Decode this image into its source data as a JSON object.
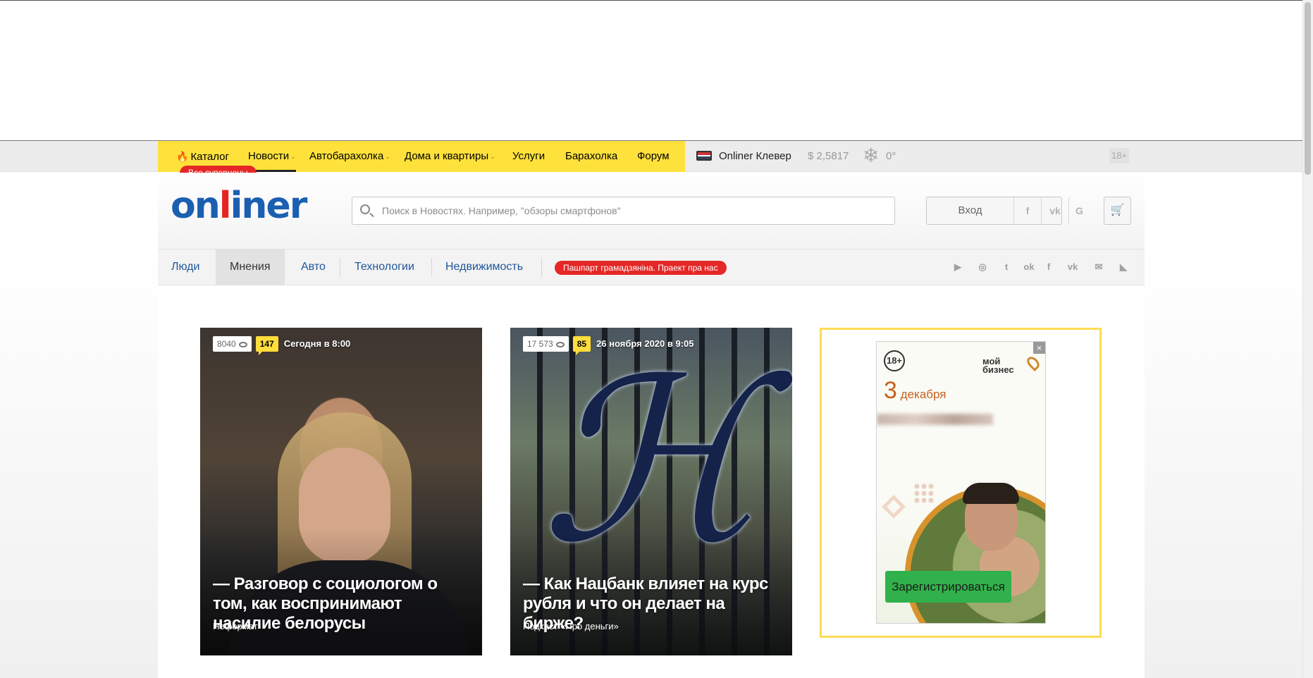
{
  "topnav": {
    "items": [
      {
        "label": "Каталог",
        "dropdown": false
      },
      {
        "label": "Новости",
        "dropdown": true
      },
      {
        "label": "Автобарахолка",
        "dropdown": true
      },
      {
        "label": "Дома и квартиры",
        "dropdown": true
      },
      {
        "label": "Услуги",
        "dropdown": false
      },
      {
        "label": "Барахолка",
        "dropdown": false
      },
      {
        "label": "Форум",
        "dropdown": false
      }
    ],
    "badge": "Все суперцены",
    "clever": "Onliner Клевер",
    "currency": "$ 2,5817",
    "temperature": "0°",
    "age": "18+"
  },
  "header": {
    "logo": {
      "part1": "on",
      "part2": "l",
      "part3": "iner"
    },
    "search_placeholder": "Поиск в Новостях. Например, \"обзоры смартфонов\"",
    "login_label": "Вход",
    "social_login": [
      "f",
      "vk",
      "G"
    ],
    "icons": {
      "search": "search-icon",
      "cart": "cart-icon"
    }
  },
  "subnav": {
    "items": [
      "Люди",
      "Мнения",
      "Авто",
      "Технологии",
      "Недвижимость"
    ],
    "active": "Мнения",
    "promo": "Пашпарт грамадзяніна. Праект пра нас",
    "social_icons": [
      "youtube-icon",
      "instagram-icon",
      "twitter-icon",
      "odnoklassniki-icon",
      "facebook-icon",
      "vk-icon",
      "mail-icon",
      "rss-icon"
    ]
  },
  "cards": [
    {
      "views": "8040",
      "comments": "147",
      "date": "Сегодня в 8:00",
      "title": "— Разговор с социологом о том, как воспринимают насилие белорусы",
      "subtitle": "Неформат"
    },
    {
      "views": "17 573",
      "comments": "85",
      "date": "26 ноября 2020 в 9:05",
      "title": "— Как Нацбанк влияет на курс рубля и что он делает на бирже?",
      "subtitle": "Подкаст «Про деньги»"
    }
  ],
  "ad": {
    "age": "18+",
    "brand": "мой\nбизнес",
    "date_day": "3",
    "date_month": "декабря",
    "button": "Зарегистрироваться",
    "close": "×"
  },
  "colors": {
    "brand_blue": "#1b5fb1",
    "brand_red": "#e52421",
    "nav_yellow": "#ffe13b",
    "promo_red": "#e52727",
    "cta_green": "#31b14b"
  }
}
